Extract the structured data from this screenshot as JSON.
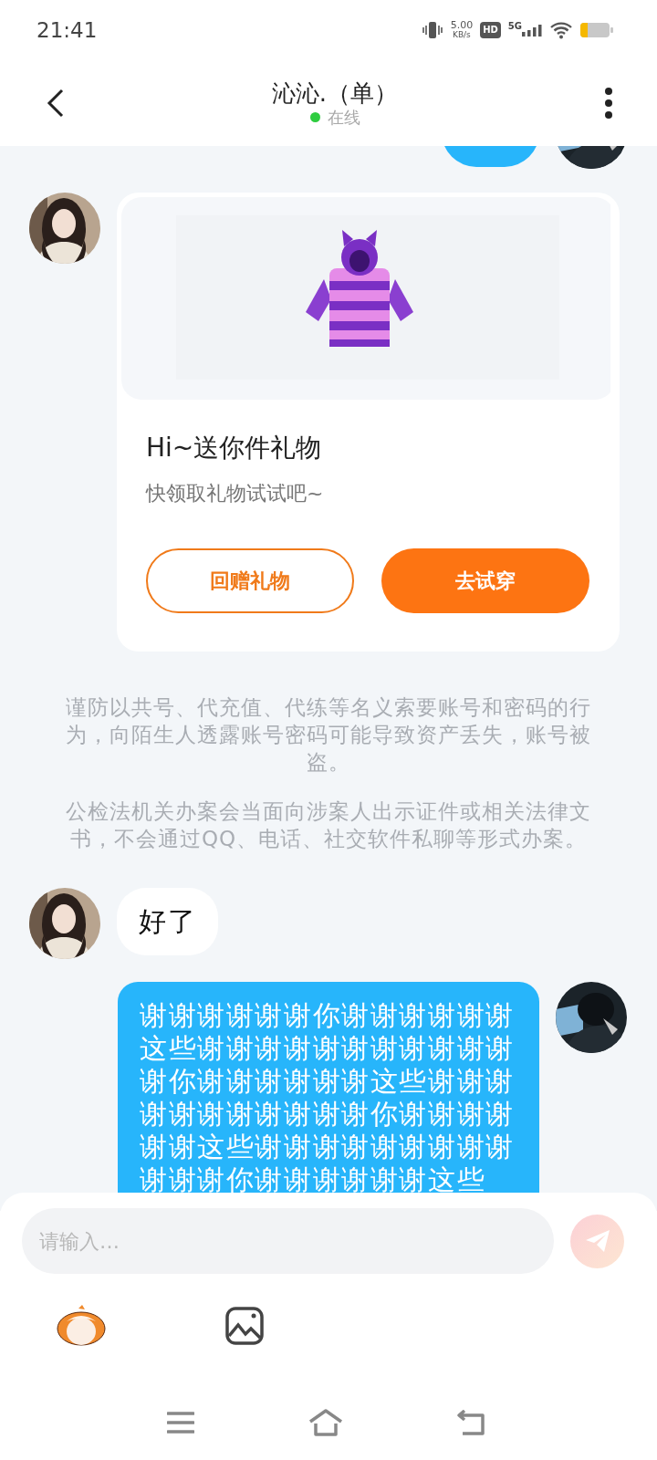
{
  "status_bar": {
    "time": "21:41",
    "speed": "5.00",
    "speed_unit": "KB/s",
    "hd": "HD",
    "network": "5G"
  },
  "header": {
    "title": "沁沁.（单）",
    "status": "在线",
    "online": true
  },
  "messages": [
    {
      "kind": "partial",
      "outgoing": true
    },
    {
      "kind": "gift",
      "outgoing": false,
      "title": "Hi~送你件礼物",
      "subtitle": "快领取礼物试试吧~",
      "buttons": [
        {
          "label": "回赠礼物",
          "kind": "outline"
        },
        {
          "label": "去试穿",
          "kind": "filled"
        }
      ]
    },
    {
      "kind": "notice",
      "paragraphs": [
        "谨防以共号、代充值、代练等名义索要账号和密码的行为，向陌生人透露账号密码可能导致资产丢失，账号被盗。",
        "公检法机关办案会当面向涉案人出示证件或相关法律文书，不会通过QQ、电话、社交软件私聊等形式办案。"
      ]
    },
    {
      "kind": "text",
      "outgoing": false,
      "text": "好了"
    },
    {
      "kind": "text",
      "outgoing": true,
      "text": "谢谢谢谢谢谢你谢谢谢谢谢谢这些谢谢谢谢谢谢谢谢谢谢谢谢你谢谢谢谢谢谢这些谢谢谢谢谢谢谢谢谢谢谢你谢谢谢谢谢谢这些谢谢谢谢谢谢谢谢谢谢谢谢你谢谢谢谢谢谢这些"
    }
  ],
  "composer": {
    "placeholder": "请输入…",
    "send_disabled": true
  }
}
